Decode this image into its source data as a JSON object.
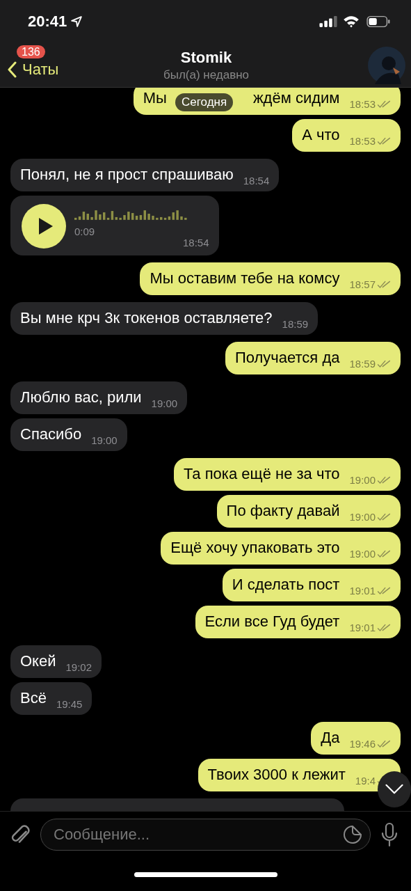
{
  "status_bar": {
    "time": "20:41"
  },
  "header": {
    "back_label": "Чаты",
    "unread_badge": "136",
    "title": "Stomik",
    "subtitle": "был(а) недавно"
  },
  "date_badge": "Сегодня",
  "messages": [
    {
      "kind": "outgoing",
      "text": "Мы",
      "text_after_badge": "ждём сидим",
      "time": "18:53"
    },
    {
      "kind": "outgoing",
      "text": "А что",
      "time": "18:53"
    },
    {
      "kind": "incoming",
      "text": "Понял, не я прост спрашиваю",
      "time": "18:54"
    },
    {
      "kind": "incoming_voice",
      "duration": "0:09",
      "time": "18:54"
    },
    {
      "kind": "outgoing",
      "text": "Мы оставим тебе на комсу",
      "time": "18:57"
    },
    {
      "kind": "incoming",
      "text": "Вы мне крч 3к токенов оставляете?",
      "time": "18:59"
    },
    {
      "kind": "outgoing",
      "text": "Получается да",
      "time": "18:59"
    },
    {
      "kind": "incoming",
      "text": "Люблю вас, рили",
      "time": "19:00"
    },
    {
      "kind": "incoming",
      "text": "Спасибо",
      "time": "19:00"
    },
    {
      "kind": "outgoing",
      "text": "Та пока ещё не за что",
      "time": "19:00"
    },
    {
      "kind": "outgoing",
      "text": "По факту давай",
      "time": "19:00"
    },
    {
      "kind": "outgoing",
      "text": "Ещё хочу упаковать это",
      "time": "19:00"
    },
    {
      "kind": "outgoing",
      "text": "И сделать пост",
      "time": "19:01"
    },
    {
      "kind": "outgoing",
      "text": "Если все Гуд будет",
      "time": "19:01"
    },
    {
      "kind": "incoming",
      "text": "Окей",
      "time": "19:02"
    },
    {
      "kind": "incoming",
      "text": "Всё",
      "time": "19:45"
    },
    {
      "kind": "outgoing",
      "text": "Да",
      "time": "19:46"
    },
    {
      "kind": "outgoing",
      "text": "Твоих 3000 к лежит",
      "time": "19:4"
    }
  ],
  "composer": {
    "placeholder": "Сообщение..."
  }
}
